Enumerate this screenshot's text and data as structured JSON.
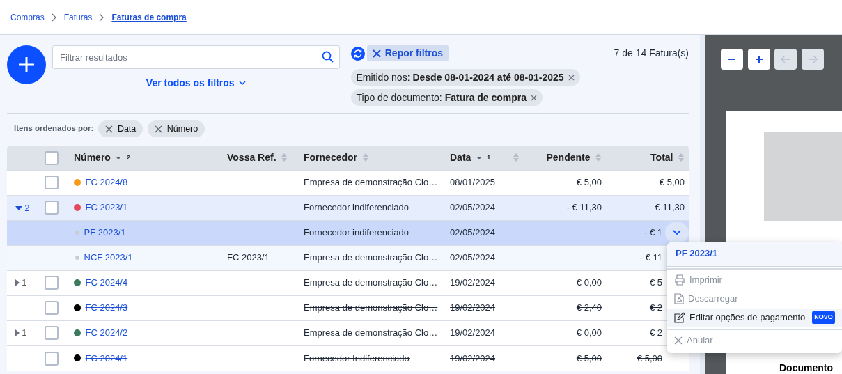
{
  "breadcrumb": [
    {
      "label": "Compras",
      "current": false
    },
    {
      "label": "Faturas",
      "current": false
    },
    {
      "label": "Faturas de compra",
      "current": true
    }
  ],
  "toolbar": {
    "search": {
      "placeholder": "Filtrar resultados"
    },
    "all_filters_link": "Ver todos os filtros",
    "reset_filters": "Repor filtros",
    "result_count": "7 de 14 Fatura(s)"
  },
  "active_filters": [
    {
      "label": "Emitido nos:",
      "value": "Desde 08-01-2024 até 08-01-2025"
    },
    {
      "label": "Tipo de documento:",
      "value": "Fatura de compra"
    }
  ],
  "sort_bar": {
    "label": "Itens ordenados por:",
    "chips": [
      "Data",
      "Número"
    ]
  },
  "table": {
    "header_checkbox": {
      "checked": false
    },
    "columns": [
      {
        "kind": "expander"
      },
      {
        "kind": "checkbox"
      },
      {
        "kind": "text",
        "label": "Número",
        "sorted": true,
        "sort_rank": "2"
      },
      {
        "kind": "text",
        "label": "Vossa Ref.",
        "sorted": false
      },
      {
        "kind": "text",
        "label": "Fornecedor",
        "sorted": false
      },
      {
        "kind": "text",
        "label": "Data",
        "sorted": true,
        "sort_rank": "1"
      },
      {
        "kind": "text",
        "sorted": false
      },
      {
        "kind": "amount",
        "label": "Pendente",
        "sorted": false
      },
      {
        "kind": "amount",
        "label": "Total",
        "sorted": false
      }
    ],
    "rows": [
      {
        "kind": "parent",
        "checked": false,
        "color": "#f59c1a",
        "number": "FC 2024/8",
        "supplier": "Empresa de demonstração Clo…",
        "date": "08/01/2025",
        "pending": "€ 5,00",
        "total": "€ 5,00",
        "cancelled": false,
        "selected": false,
        "menu_open": false
      },
      {
        "kind": "parent",
        "expanded": true,
        "children_count": "2",
        "checked": false,
        "color": "#e5485d",
        "number": "FC 2023/1",
        "supplier": "Fornecedor indiferenciado",
        "date": "02/05/2024",
        "pending": "- € 11,30",
        "total": "€ 11,30",
        "cancelled": false,
        "selected": false,
        "menu_open": false
      },
      {
        "kind": "child",
        "number": "PF 2023/1",
        "supplier": "Fornecedor indiferenciado",
        "date": "02/05/2024",
        "total": "- € 1",
        "cancelled": false,
        "selected": true,
        "menu_open": true
      },
      {
        "kind": "child",
        "number": "NCF 2023/1",
        "ref": "FC 2023/1",
        "supplier": "Empresa de demonstração Clo…",
        "date": "02/05/2024",
        "total": "- € 11",
        "cancelled": false,
        "selected": false,
        "menu_open": false
      },
      {
        "kind": "parent",
        "expanded": false,
        "children_count": "1",
        "checked": false,
        "color": "#3d7a5c",
        "number": "FC 2024/4",
        "supplier": "Empresa de demonstração Clo…",
        "date": "19/02/2024",
        "pending": "€ 0,00",
        "total": "€ 5",
        "cancelled": false,
        "selected": false,
        "menu_open": false
      },
      {
        "kind": "parent",
        "checked": false,
        "color": "#000000",
        "number": "FC 2024/3",
        "supplier": "Empresa de demonstração Clo…",
        "date": "19/02/2024",
        "pending": "€ 2,40",
        "total": "€ 2",
        "cancelled": true,
        "selected": false,
        "menu_open": false
      },
      {
        "kind": "parent",
        "expanded": false,
        "children_count": "1",
        "checked": false,
        "color": "#3d7a5c",
        "number": "FC 2024/2",
        "supplier": "Empresa de demonstração Clo…",
        "date": "19/02/2024",
        "pending": "€ 0,00",
        "total": "€ 2",
        "cancelled": false,
        "selected": false,
        "menu_open": false
      },
      {
        "kind": "parent",
        "checked": false,
        "color": "#000000",
        "number": "FC 2024/1",
        "supplier": "Fornecedor Indiferenciado",
        "date": "19/02/2024",
        "pending": "€ 5,00",
        "total": "€ 5,00",
        "cancelled": true,
        "selected": false,
        "menu_open": false
      }
    ]
  },
  "row_menu": {
    "title": "PF 2023/1",
    "items": [
      {
        "kind": "print",
        "label": "Imprimir",
        "disabled": true,
        "highlighted": false,
        "divider_before": false
      },
      {
        "kind": "download",
        "label": "Descarregar",
        "disabled": true,
        "highlighted": false,
        "divider_before": false
      },
      {
        "kind": "edit",
        "label": "Editar opções de pagamento",
        "badge": "NOVO",
        "disabled": false,
        "highlighted": true,
        "divider_before": false
      },
      {
        "kind": "cancel",
        "label": "Anular",
        "disabled": true,
        "highlighted": false,
        "divider_before": true
      }
    ]
  },
  "viewer": {
    "buttons": [
      {
        "kind": "zoom_out",
        "disabled": false
      },
      {
        "kind": "zoom_in",
        "disabled": false
      },
      {
        "kind": "previous",
        "disabled": true
      },
      {
        "kind": "next",
        "disabled": true
      }
    ],
    "page_text": "Documento"
  }
}
